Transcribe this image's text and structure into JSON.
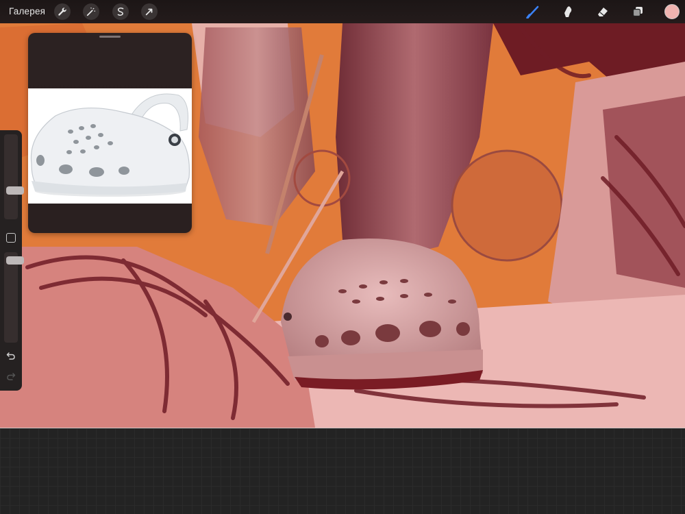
{
  "toolbar": {
    "gallery_label": "Галерея",
    "left_tools": [
      {
        "name": "actions",
        "icon": "wrench-icon"
      },
      {
        "name": "adjustments",
        "icon": "magic-wand-icon"
      },
      {
        "name": "selection",
        "icon": "selection-s-icon"
      },
      {
        "name": "transform",
        "icon": "arrow-cursor-icon"
      }
    ],
    "right_tools": [
      {
        "name": "brush",
        "icon": "brush-icon",
        "active": true
      },
      {
        "name": "smudge",
        "icon": "smudge-finger-icon",
        "active": false
      },
      {
        "name": "eraser",
        "icon": "eraser-icon",
        "active": false
      },
      {
        "name": "layers",
        "icon": "layers-icon",
        "active": false
      }
    ],
    "current_color": "#f0b4b0",
    "active_tool_color": "#3b82f6"
  },
  "sidebar": {
    "brush_size_level": 0.32,
    "opacity_level": 0.95,
    "modify_icon": "square-icon",
    "undo_icon": "undo-icon",
    "redo_icon": "redo-icon"
  },
  "reference": {
    "title_bar_icon": "grab-handle-icon",
    "image_subject": "white-clog-icon"
  }
}
